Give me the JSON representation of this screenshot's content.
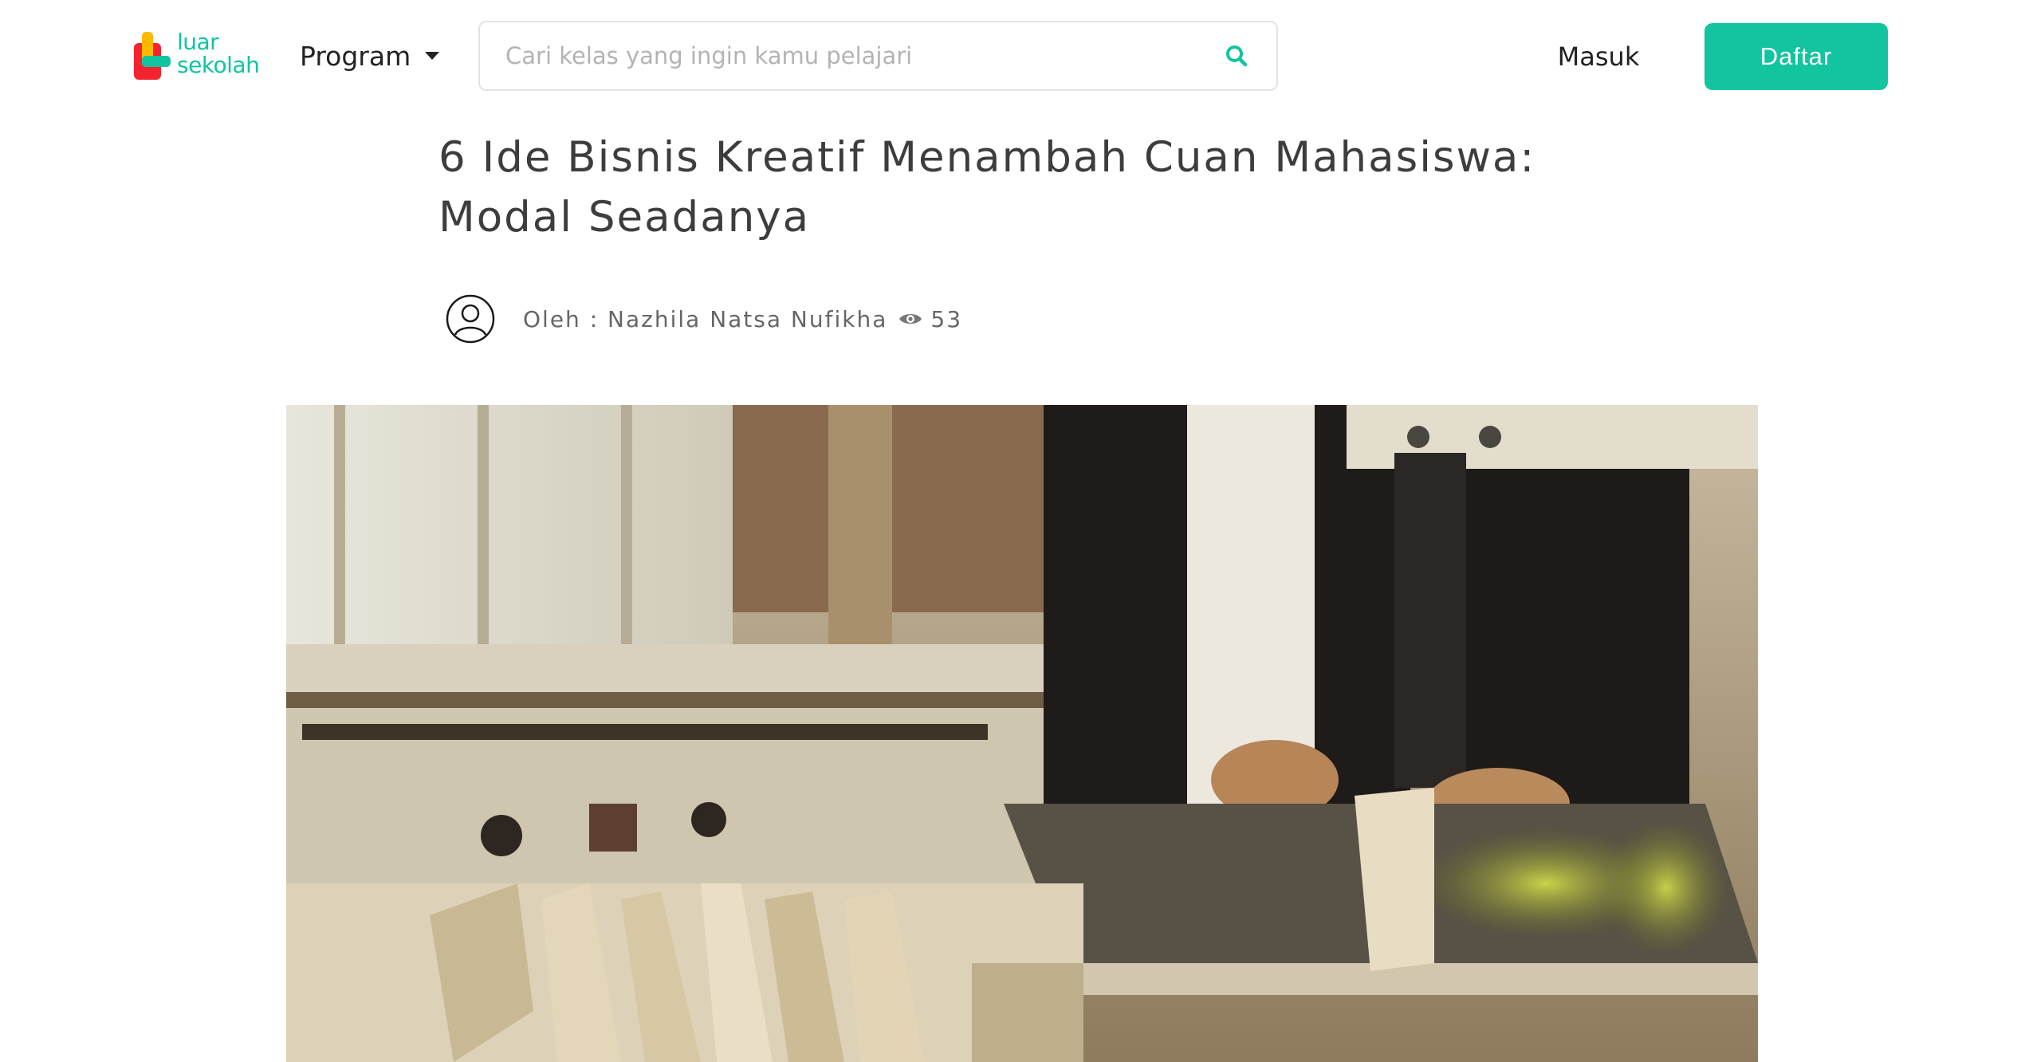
{
  "brand": {
    "logo_line1": "luar",
    "logo_line2": "sekolah",
    "accent_color": "#12c4a0"
  },
  "nav": {
    "program_label": "Program",
    "search_placeholder": "Cari kelas yang ingin kamu pelajari",
    "search_value": "",
    "login_label": "Masuk",
    "register_label": "Daftar",
    "icons": {
      "dropdown": "caret-down-icon",
      "search": "search-icon"
    }
  },
  "article": {
    "title": "6 Ide Bisnis Kreatif Menambah Cuan Mahasiswa: Modal Seadanya",
    "author_line": "Oleh : Nazhila Natsa Nufikha",
    "views": "53",
    "icons": {
      "avatar": "user-avatar-icon",
      "views": "eye-icon"
    },
    "hero_image": "woodworker-bandsaw-photo"
  }
}
